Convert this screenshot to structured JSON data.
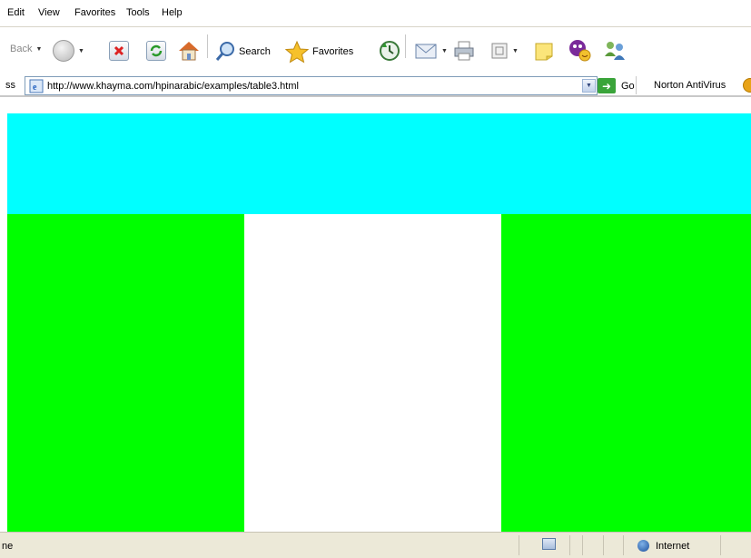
{
  "menu": {
    "items": [
      "Edit",
      "View",
      "Favorites",
      "Tools",
      "Help"
    ]
  },
  "toolbar": {
    "back_label": "Back",
    "search_label": "Search",
    "favorites_label": "Favorites",
    "icons": [
      "back-icon",
      "forward-icon",
      "stop-icon",
      "refresh-icon",
      "home-icon",
      "search-icon",
      "favorites-star-icon",
      "history-icon",
      "mail-icon",
      "print-icon",
      "edit-icon",
      "notes-icon",
      "messenger-icon",
      "contacts-icon"
    ]
  },
  "address": {
    "label": "ss",
    "url": "http://www.khayma.com/hpinarabic/examples/table3.html",
    "go_label": "Go",
    "norton_label": "Norton AntiVirus"
  },
  "page": {
    "table": {
      "top_row_color": "#00ffff",
      "bottom_row_colors": [
        "#00ff00",
        "#ffffff",
        "#00ff00"
      ]
    }
  },
  "status": {
    "text": "ne",
    "zone_label": "Internet"
  },
  "colors": {
    "cyan": "#00ffff",
    "green": "#00ff00",
    "white": "#ffffff",
    "statusbar": "#ece9d8"
  }
}
